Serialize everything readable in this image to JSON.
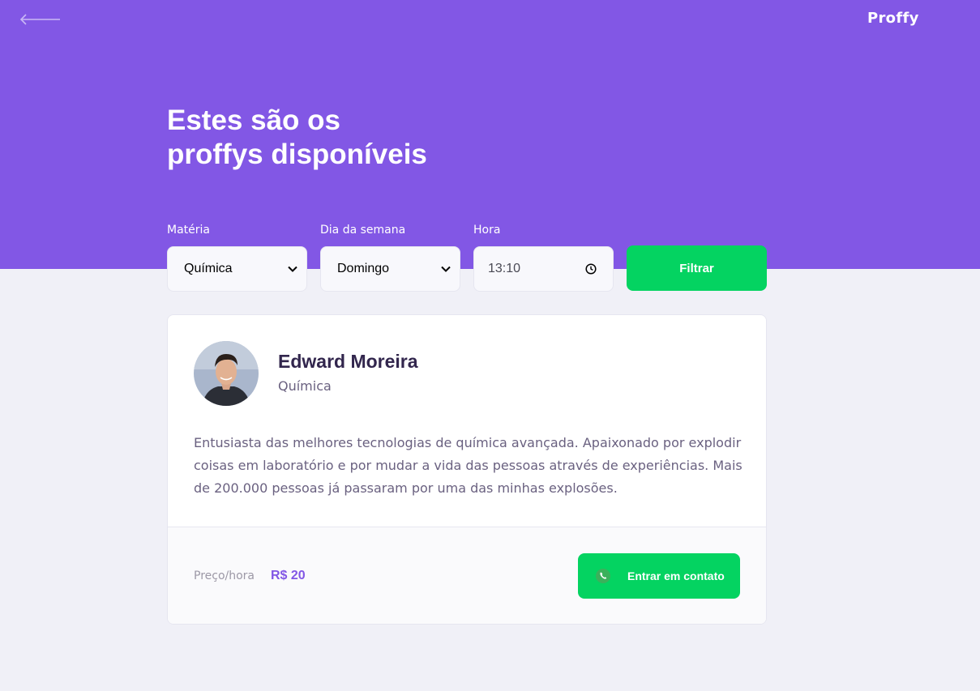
{
  "header": {
    "back_icon": "arrow-left-icon",
    "logo": "Proffy",
    "title_line1": "Estes são os",
    "title_line2": "proffys disponíveis"
  },
  "filters": {
    "subject": {
      "label": "Matéria",
      "value": "Química"
    },
    "weekday": {
      "label": "Dia da semana",
      "value": "Domingo"
    },
    "time": {
      "label": "Hora",
      "value": "13:10"
    },
    "submit_label": "Filtrar"
  },
  "teacher": {
    "name": "Edward Moreira",
    "subject": "Química",
    "bio": "Entusiasta das melhores tecnologias de química avançada. Apaixonado por explodir coisas em laboratório e por mudar a vida das pessoas através de experiências. Mais de 200.000 pessoas já passaram por uma das minhas explosões.",
    "price_label": "Preço/hora",
    "price": "R$ 20",
    "contact_label": "Entrar em contato",
    "contact_icon": "whatsapp-icon"
  },
  "colors": {
    "primary": "#8257E5",
    "secondary": "#04D361",
    "background": "#F0F0F7",
    "title_text": "#32264D",
    "body_text": "#6A6180"
  }
}
